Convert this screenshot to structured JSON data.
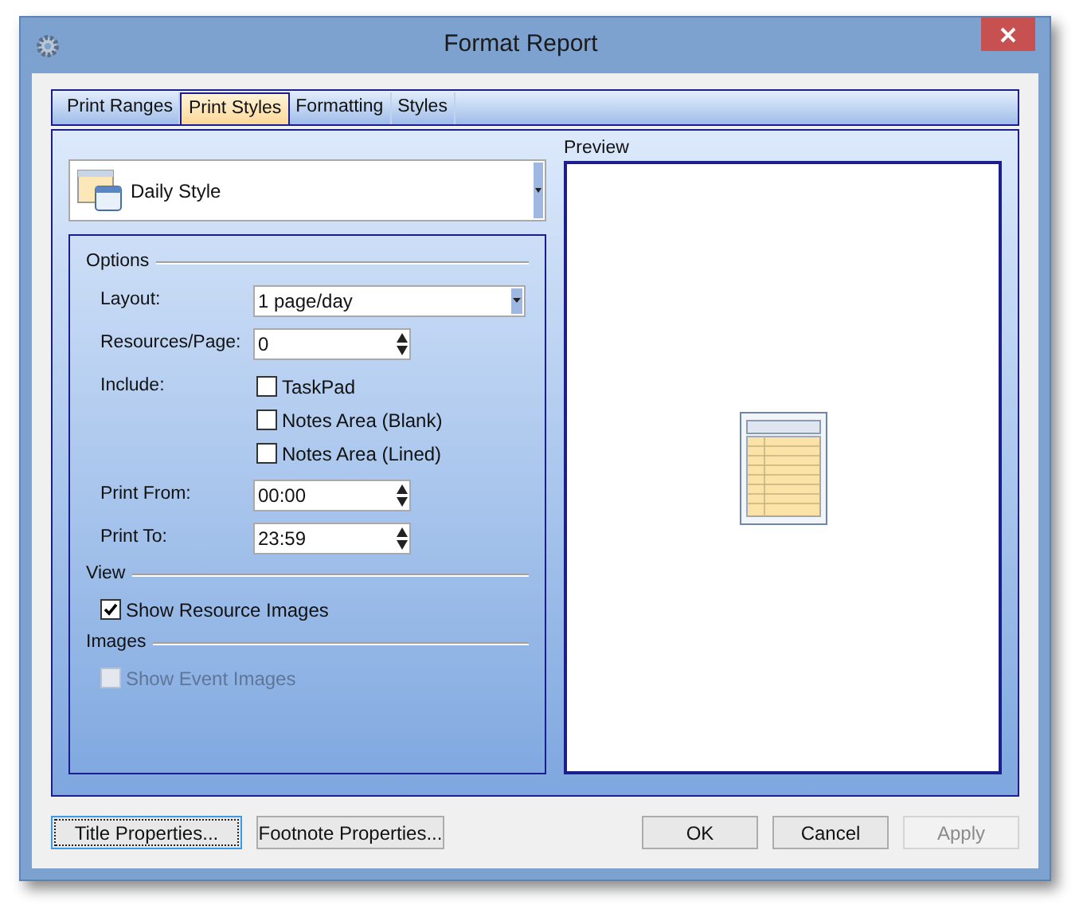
{
  "window": {
    "title": "Format Report"
  },
  "tabs": [
    {
      "label": "Print Ranges",
      "selected": false
    },
    {
      "label": "Print Styles",
      "selected": true
    },
    {
      "label": "Formatting",
      "selected": false
    },
    {
      "label": "Styles",
      "selected": false
    }
  ],
  "style_select": {
    "value": "Daily Style"
  },
  "sections": [
    {
      "heading": "Options",
      "rows": [
        {
          "kind": "select",
          "label": "Layout:",
          "value": "1 page/day",
          "disabled": false
        },
        {
          "kind": "spin",
          "label": "Resources/Page:",
          "value": "0",
          "disabled": false
        },
        {
          "kind": "checklist",
          "label": "Include:",
          "items": [
            {
              "label": "TaskPad",
              "checked": false,
              "disabled": false
            },
            {
              "label": "Notes Area (Blank)",
              "checked": false,
              "disabled": false
            },
            {
              "label": "Notes Area (Lined)",
              "checked": false,
              "disabled": false
            }
          ]
        },
        {
          "kind": "spin",
          "label": "Print From:",
          "value": "00:00",
          "disabled": false
        },
        {
          "kind": "spin",
          "label": "Print To:",
          "value": "23:59",
          "disabled": false
        }
      ]
    },
    {
      "heading": "View",
      "rows": [
        {
          "kind": "checkbox",
          "label": "Show Resource Images",
          "checked": true,
          "disabled": false
        }
      ]
    },
    {
      "heading": "Images",
      "rows": [
        {
          "kind": "checkbox",
          "label": "Show Event Images",
          "checked": false,
          "disabled": true
        }
      ]
    }
  ],
  "preview": {
    "label": "Preview"
  },
  "left_buttons": [
    {
      "label": "Title Properties...",
      "focused": true,
      "disabled": false
    },
    {
      "label": "Footnote Properties...",
      "focused": false,
      "disabled": false
    }
  ],
  "right_buttons": [
    {
      "label": "OK",
      "focused": false,
      "disabled": false
    },
    {
      "label": "Cancel",
      "focused": false,
      "disabled": false
    },
    {
      "label": "Apply",
      "focused": false,
      "disabled": true
    }
  ]
}
